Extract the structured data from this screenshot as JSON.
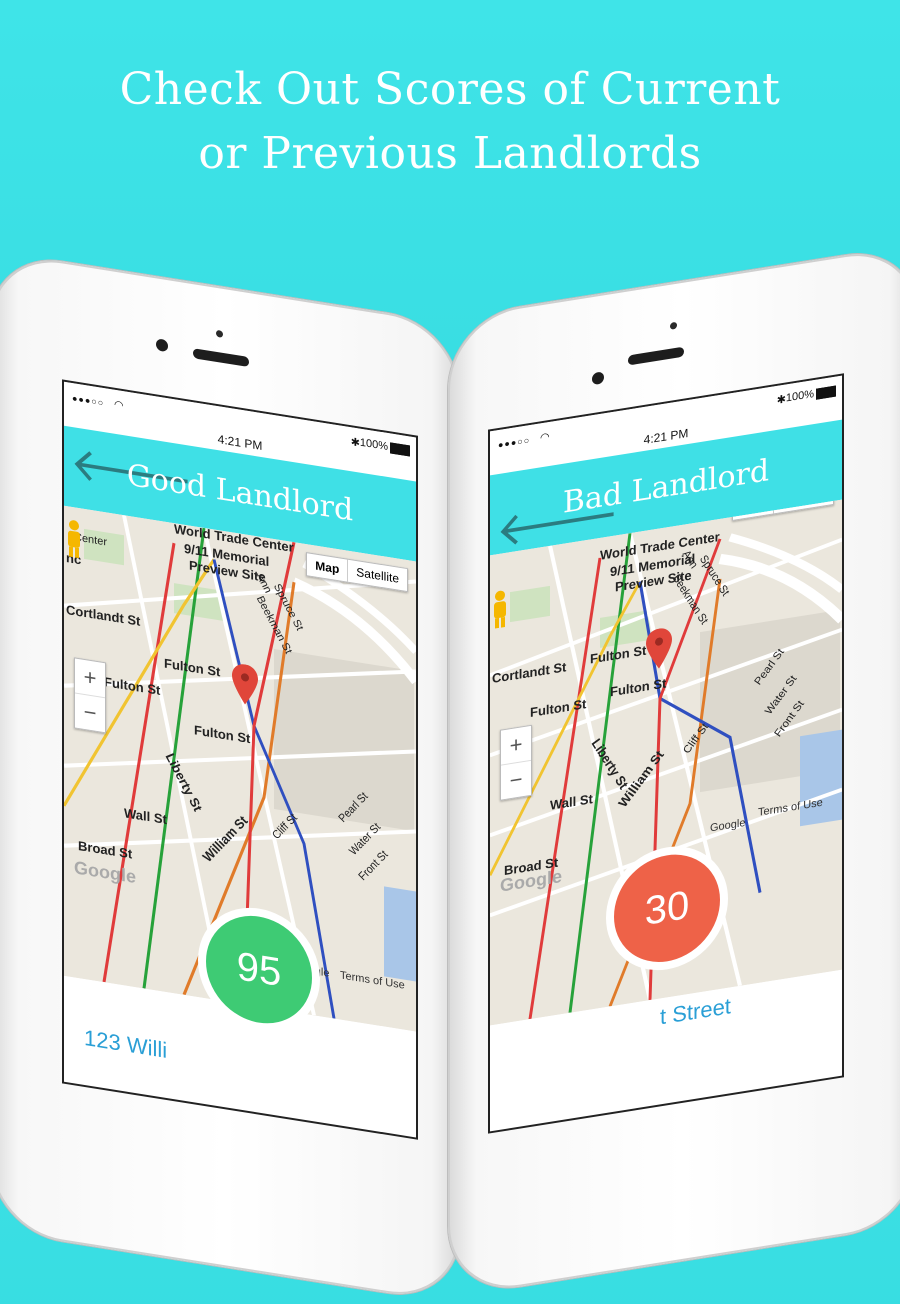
{
  "headline": {
    "line1": "Check Out Scores of Current",
    "line2": "or Previous Landlords"
  },
  "colors": {
    "background": "#3fe4e8",
    "appbar": "#3fe0e6",
    "good_score": "#3ecb74",
    "bad_score": "#ee6248",
    "route_red": "#e03b3b",
    "route_blue": "#2f4fc0",
    "route_green": "#27a23a",
    "route_yellow": "#f1c431"
  },
  "phones": [
    {
      "status": {
        "time": "4:21 PM",
        "battery": "100%"
      },
      "appbar": {
        "title": "Good Landlord",
        "back_icon": "back-arrow-icon"
      },
      "map": {
        "map_button": "Map",
        "satellite_button": "Satellite",
        "zoom_in": "+",
        "zoom_out": "−",
        "labels": {
          "world_trade_center": "World Trade Center",
          "memorial": "9/11 Memorial",
          "preview_site": "Preview Site",
          "cortlandt": "Cortlandt St",
          "fulton1": "Fulton St",
          "fulton2": "Fulton St",
          "fulton3": "Fulton St",
          "beekman": "Beekman St",
          "spruce": "Spruce St",
          "liberty": "Liberty St",
          "william": "William St",
          "wall": "Wall St",
          "broad": "Broad St",
          "cliff": "Cliff St",
          "pearl": "Pearl St",
          "water": "Water St",
          "front": "Front St",
          "ann": "Ann",
          "center": "Center",
          "nc": "nc"
        },
        "google": "Google",
        "terms": "Terms of Use",
        "logo": "Google"
      },
      "score": "95",
      "address": "123 Willi"
    },
    {
      "status": {
        "time": "4:21 PM",
        "battery": "100%"
      },
      "appbar": {
        "title": "Bad Landlord",
        "back_icon": "back-arrow-icon"
      },
      "map": {
        "map_button": "Map",
        "satellite_button": "Satellite",
        "zoom_in": "+",
        "zoom_out": "−",
        "labels": {
          "world_trade_center": "World Trade Center",
          "memorial": "9/11 Memorial",
          "preview_site": "Preview Site",
          "cortlandt": "Cortlandt St",
          "fulton1": "Fulton St",
          "fulton2": "Fulton St",
          "fulton3": "Fulton St",
          "beekman": "Beekman St",
          "spruce": "Spruce St",
          "liberty": "Liberty St",
          "william": "William St",
          "wall": "Wall St",
          "broad": "Broad St",
          "cliff": "Cliff St",
          "pearl": "Pearl St",
          "water": "Water St",
          "front": "Front St",
          "ann": "Ann",
          "center": "",
          "nc": ""
        },
        "google": "Google",
        "terms": "Terms of Use",
        "logo": "Google"
      },
      "score": "30",
      "address": "t Street"
    }
  ]
}
